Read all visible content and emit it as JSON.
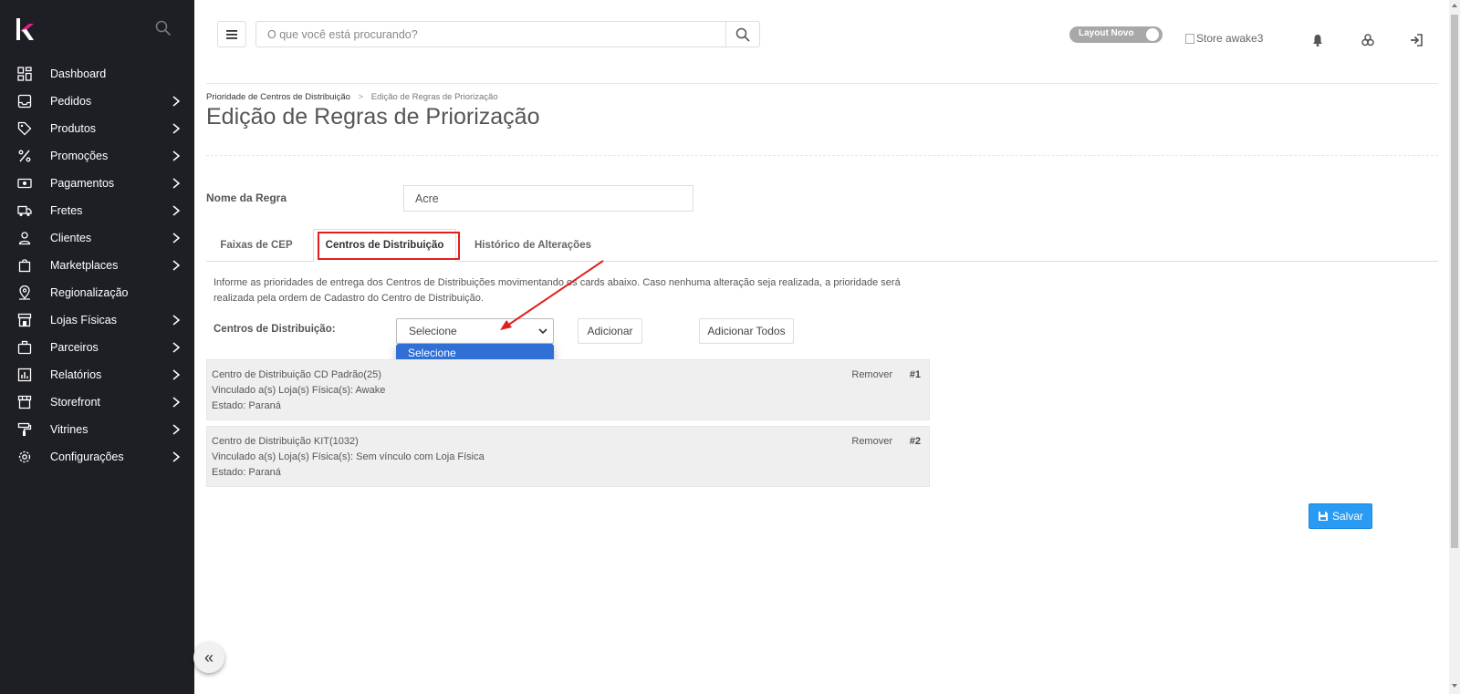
{
  "sidebar": {
    "items": [
      {
        "label": "Dashboard",
        "icon": "dashboard-icon",
        "has_submenu": false
      },
      {
        "label": "Pedidos",
        "icon": "inbox-icon",
        "has_submenu": true
      },
      {
        "label": "Produtos",
        "icon": "tag-icon",
        "has_submenu": true
      },
      {
        "label": "Promoções",
        "icon": "percent-icon",
        "has_submenu": true
      },
      {
        "label": "Pagamentos",
        "icon": "money-icon",
        "has_submenu": true
      },
      {
        "label": "Fretes",
        "icon": "truck-icon",
        "has_submenu": true
      },
      {
        "label": "Clientes",
        "icon": "user-icon",
        "has_submenu": true
      },
      {
        "label": "Marketplaces",
        "icon": "shopping-bag-icon",
        "has_submenu": true
      },
      {
        "label": "Regionalização",
        "icon": "location-pin-icon",
        "has_submenu": false
      },
      {
        "label": "Lojas Físicas",
        "icon": "store-icon",
        "has_submenu": true
      },
      {
        "label": "Parceiros",
        "icon": "briefcase-icon",
        "has_submenu": true
      },
      {
        "label": "Relatórios",
        "icon": "report-icon",
        "has_submenu": true
      },
      {
        "label": "Storefront",
        "icon": "storefront-icon",
        "has_submenu": true
      },
      {
        "label": "Vitrines",
        "icon": "paint-roller-icon",
        "has_submenu": true
      },
      {
        "label": "Configurações",
        "icon": "gear-icon",
        "has_submenu": true
      }
    ]
  },
  "topbar": {
    "search_placeholder": "O que você está procurando?",
    "layout_toggle_label": "Layout Novo",
    "store_image_alt": "Store awake3"
  },
  "breadcrumb": {
    "parent": "Prioridade de Centros de Distribuição",
    "separator": ">",
    "current": "Edição de Regras de Priorização"
  },
  "page": {
    "title": "Edição de Regras de Priorização",
    "rule_name_label": "Nome da Regra",
    "rule_name_value": "Acre"
  },
  "tabs": [
    {
      "label": "Faixas de CEP"
    },
    {
      "label": "Centros de Distribuição"
    },
    {
      "label": "Histórico de Alterações"
    }
  ],
  "distribution": {
    "info": "Informe as prioridades de entrega dos Centros de Distribuições movimentando os cards abaixo. Caso nenhuma alteração seja realizada, a prioridade será realizada pela ordem de Cadastro do Centro de Distribuição.",
    "label": "Centros de Distribuição:",
    "select_value": "Selecione",
    "dropdown_option": "Selecione",
    "add_button": "Adicionar",
    "add_all_button": "Adicionar Todos"
  },
  "cards": [
    {
      "name": "Centro de Distribuição CD Padrão(25)",
      "link": "Vinculado a(s) Loja(s) Física(s): Awake",
      "state": "Estado: Paraná",
      "remove": "Remover",
      "rank": "#1"
    },
    {
      "name": "Centro de Distribuição KIT(1032)",
      "link": "Vinculado a(s) Loja(s) Física(s): Sem vínculo com Loja Física",
      "state": "Estado: Paraná",
      "remove": "Remover",
      "rank": "#2"
    }
  ],
  "save_button": "Salvar",
  "collapse_glyph": "«",
  "colors": {
    "sidebar_bg": "#1e1f24",
    "highlight_red": "#e02020",
    "save_blue": "#2a9bf2",
    "dropdown_blue": "#2f6fd6"
  }
}
